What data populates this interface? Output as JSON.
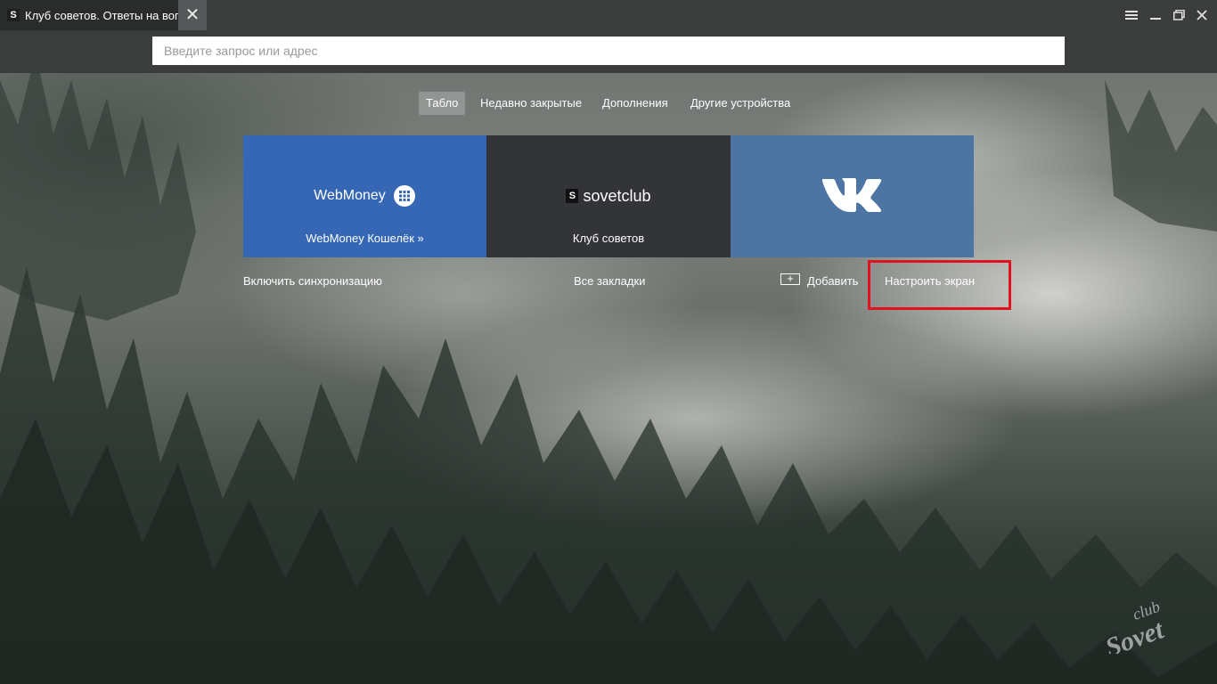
{
  "browser": {
    "tab": {
      "favicon": "S",
      "title": "Клуб советов. Ответы на вопросы",
      "close_icon": "close-icon"
    },
    "window_controls": [
      "menu-icon",
      "minimize-icon",
      "restore-icon",
      "close-icon"
    ],
    "address_bar": {
      "placeholder": "Введите запрос или адрес",
      "value": ""
    }
  },
  "nav": {
    "tabs": [
      {
        "label": "Табло",
        "active": true
      },
      {
        "label": "Недавно закрытые",
        "active": false
      },
      {
        "label": "Дополнения",
        "active": false
      },
      {
        "label": "Другие устройства",
        "active": false
      }
    ]
  },
  "tiles": [
    {
      "logo_text": "WebMoney",
      "logo_icon": "webmoney-globe-icon",
      "caption": "WebMoney Кошелёк »",
      "color": "#3567b5"
    },
    {
      "logo_badge": "S",
      "logo_text": "sovetclub",
      "caption": "Клуб советов",
      "color": "#323438"
    },
    {
      "logo_icon": "vk-logo-icon",
      "caption": "",
      "color": "#4c75a3"
    }
  ],
  "links": {
    "sync": "Включить синхронизацию",
    "bookmarks": "Все закладки",
    "add": "Добавить",
    "add_icon": "plus-icon",
    "customize": "Настроить экран"
  },
  "highlight_color": "#e0121f",
  "watermark": {
    "top": "club",
    "bottom": "Sovet"
  }
}
